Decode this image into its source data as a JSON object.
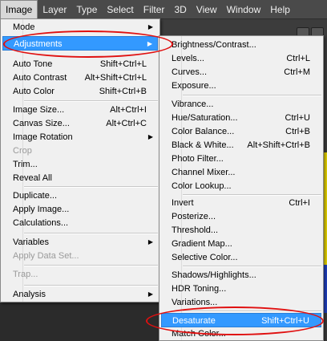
{
  "menubar": [
    "Image",
    "Layer",
    "Type",
    "Select",
    "Filter",
    "3D",
    "View",
    "Window",
    "Help"
  ],
  "image_menu": {
    "items": [
      {
        "label": "Mode",
        "shortcut": "",
        "submenu": true,
        "disabled": false
      },
      {
        "label": "Adjustments",
        "shortcut": "",
        "submenu": true,
        "disabled": false,
        "highlighted": true
      },
      {
        "label": "Auto Tone",
        "shortcut": "Shift+Ctrl+L"
      },
      {
        "label": "Auto Contrast",
        "shortcut": "Alt+Shift+Ctrl+L"
      },
      {
        "label": "Auto Color",
        "shortcut": "Shift+Ctrl+B"
      },
      {
        "label": "Image Size...",
        "shortcut": "Alt+Ctrl+I"
      },
      {
        "label": "Canvas Size...",
        "shortcut": "Alt+Ctrl+C"
      },
      {
        "label": "Image Rotation",
        "shortcut": "",
        "submenu": true
      },
      {
        "label": "Crop",
        "shortcut": "",
        "disabled": true
      },
      {
        "label": "Trim...",
        "shortcut": ""
      },
      {
        "label": "Reveal All",
        "shortcut": ""
      },
      {
        "label": "Duplicate...",
        "shortcut": ""
      },
      {
        "label": "Apply Image...",
        "shortcut": ""
      },
      {
        "label": "Calculations...",
        "shortcut": ""
      },
      {
        "label": "Variables",
        "shortcut": "",
        "submenu": true
      },
      {
        "label": "Apply Data Set...",
        "shortcut": "",
        "disabled": true
      },
      {
        "label": "Trap...",
        "shortcut": "",
        "disabled": true
      },
      {
        "label": "Analysis",
        "shortcut": "",
        "submenu": true
      }
    ]
  },
  "adjustments_menu": {
    "items": [
      {
        "label": "Brightness/Contrast...",
        "shortcut": ""
      },
      {
        "label": "Levels...",
        "shortcut": "Ctrl+L"
      },
      {
        "label": "Curves...",
        "shortcut": "Ctrl+M"
      },
      {
        "label": "Exposure...",
        "shortcut": ""
      },
      {
        "label": "Vibrance...",
        "shortcut": ""
      },
      {
        "label": "Hue/Saturation...",
        "shortcut": "Ctrl+U"
      },
      {
        "label": "Color Balance...",
        "shortcut": "Ctrl+B"
      },
      {
        "label": "Black & White...",
        "shortcut": "Alt+Shift+Ctrl+B"
      },
      {
        "label": "Photo Filter...",
        "shortcut": ""
      },
      {
        "label": "Channel Mixer...",
        "shortcut": ""
      },
      {
        "label": "Color Lookup...",
        "shortcut": ""
      },
      {
        "label": "Invert",
        "shortcut": "Ctrl+I"
      },
      {
        "label": "Posterize...",
        "shortcut": ""
      },
      {
        "label": "Threshold...",
        "shortcut": ""
      },
      {
        "label": "Gradient Map...",
        "shortcut": ""
      },
      {
        "label": "Selective Color...",
        "shortcut": ""
      },
      {
        "label": "Shadows/Highlights...",
        "shortcut": ""
      },
      {
        "label": "HDR Toning...",
        "shortcut": ""
      },
      {
        "label": "Variations...",
        "shortcut": ""
      },
      {
        "label": "Desaturate",
        "shortcut": "Shift+Ctrl+U",
        "highlighted": true
      },
      {
        "label": "Match Color...",
        "shortcut": ""
      }
    ]
  },
  "colors": {
    "highlight": "#3399ff",
    "annotation": "#e01010",
    "menu_bg": "#f0f0f0",
    "menubar_bg": "#4a4a4a"
  }
}
